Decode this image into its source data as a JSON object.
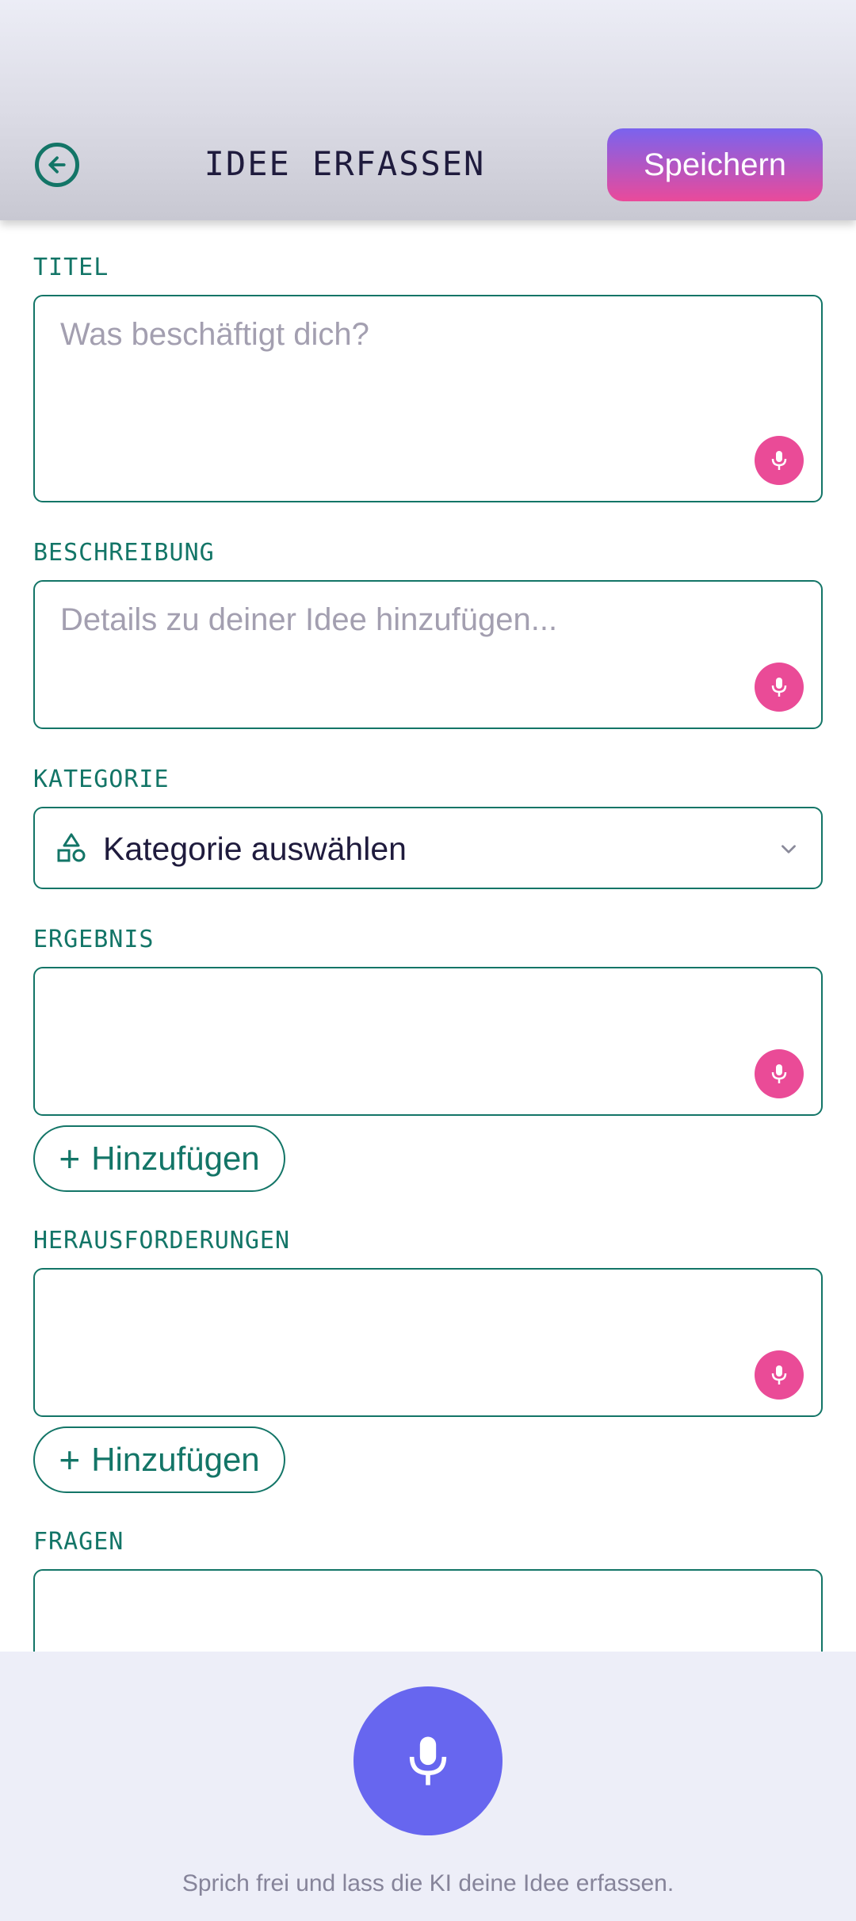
{
  "header": {
    "title": "IDEE ERFASSEN",
    "save_label": "Speichern"
  },
  "form": {
    "titel": {
      "label": "TITEL",
      "placeholder": "Was beschäftigt dich?"
    },
    "beschreibung": {
      "label": "BESCHREIBUNG",
      "placeholder": "Details zu deiner Idee hinzufügen..."
    },
    "kategorie": {
      "label": "KATEGORIE",
      "value": "Kategorie auswählen"
    },
    "ergebnis": {
      "label": "ERGEBNIS",
      "add_label": "Hinzufügen"
    },
    "herausforderungen": {
      "label": "HERAUSFORDERUNGEN",
      "add_label": "Hinzufügen"
    },
    "fragen": {
      "label": "FRAGEN"
    }
  },
  "footer": {
    "hint": "Sprich frei und lass die KI deine Idee erfassen."
  },
  "icons": {
    "back": "arrow-left-circle-icon",
    "mic": "microphone-icon",
    "category": "shapes-icon",
    "chevron": "chevron-down-icon",
    "plus": "plus-icon"
  },
  "colors": {
    "accent_teal": "#137567",
    "mic_pink": "#ea4b97",
    "primary_violet": "#6766ef"
  }
}
